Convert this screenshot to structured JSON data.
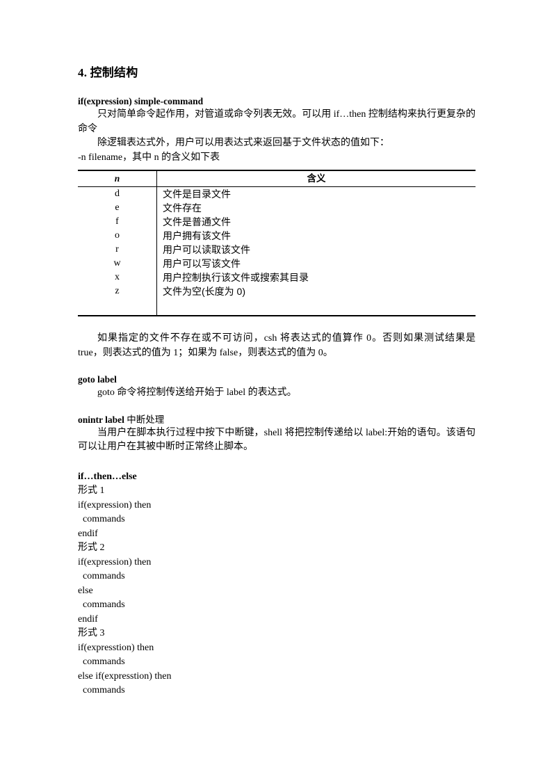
{
  "document": {
    "section_heading": "4.  控制结构",
    "blocks": [
      {
        "heading": "if(expression) simple-command",
        "paragraphs": [
          "只对简单命令起作用，对管道或命令列表无效。可以用 if…then 控制结构来执行更复杂的命令",
          "除逻辑表达式外，用户可以用表达式来返回基于文件状态的值如下："
        ],
        "tail_line": "-n filename，其中 n 的含义如下表"
      }
    ],
    "table": {
      "headers": [
        "n",
        "含义"
      ],
      "rows": [
        [
          "d",
          "文件是目录文件"
        ],
        [
          "e",
          "文件存在"
        ],
        [
          "f",
          "文件是普通文件"
        ],
        [
          "o",
          "用户拥有该文件"
        ],
        [
          "r",
          "用户可以读取该文件"
        ],
        [
          "w",
          "用户可以写该文件"
        ],
        [
          "x",
          "用户控制执行该文件或搜索其目录"
        ],
        [
          "z",
          "文件为空(长度为 0)"
        ]
      ]
    },
    "after_table_paragraph": "如果指定的文件不存在或不可访问，csh 将表达式的值算作 0。否则如果测试结果是 true，则表达式的值为 1；如果为 false，则表达式的值为 0。",
    "goto": {
      "heading": "goto label",
      "paragraph": "goto 命令将控制传送给开始于 label 的表达式。"
    },
    "onintr": {
      "heading_bold": "onintr label",
      "heading_normal": " 中断处理",
      "paragraph": "当用户在脚本执行过程中按下中断键，shell 将把控制传递给以 label:开始的语句。该语句可以让用户在其被中断时正常终止脚本。"
    },
    "ifthenelse": {
      "heading": "if…then…else",
      "lines": [
        "形式 1",
        "if(expression) then",
        "  commands",
        "endif",
        "形式 2",
        "if(expression) then",
        "  commands",
        "else",
        "  commands",
        "endif",
        "形式 3",
        "if(expresstion) then",
        "  commands",
        "else if(expresstion) then",
        "  commands"
      ]
    }
  }
}
